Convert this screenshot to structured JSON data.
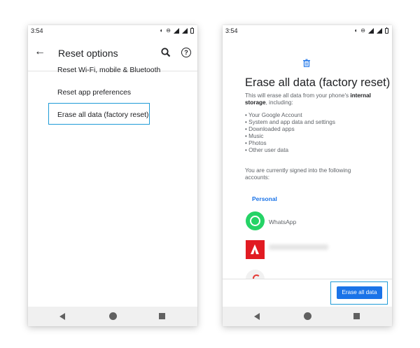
{
  "left_screen": {
    "status_time": "3:54",
    "title": "Reset options",
    "items": [
      {
        "label": "Reset Wi-Fi, mobile & Bluetooth"
      },
      {
        "label": "Reset app preferences"
      },
      {
        "label": "Erase all data (factory reset)"
      }
    ],
    "help_glyph": "?"
  },
  "right_screen": {
    "status_time": "3:54",
    "title": "Erase all data (factory reset)",
    "description_prefix": "This will erase all data from your phone's ",
    "description_bold": "internal storage",
    "description_suffix": ", including:",
    "bullets": [
      "• Your Google Account",
      "• System and app data and settings",
      "• Downloaded apps",
      "• Music",
      "• Photos",
      "• Other user data"
    ],
    "signed_in_text": "You are currently signed into the following accounts:",
    "personal_label": "Personal",
    "accounts": [
      {
        "name": "WhatsApp",
        "icon": "whatsapp-icon"
      },
      {
        "name": "",
        "icon": "adobe-icon"
      }
    ],
    "erase_button_label": "Erase all data"
  },
  "colors": {
    "accent": "#1a73e8",
    "highlight": "#1f9bd7",
    "whatsapp": "#25d366",
    "adobe": "#e11b22"
  }
}
